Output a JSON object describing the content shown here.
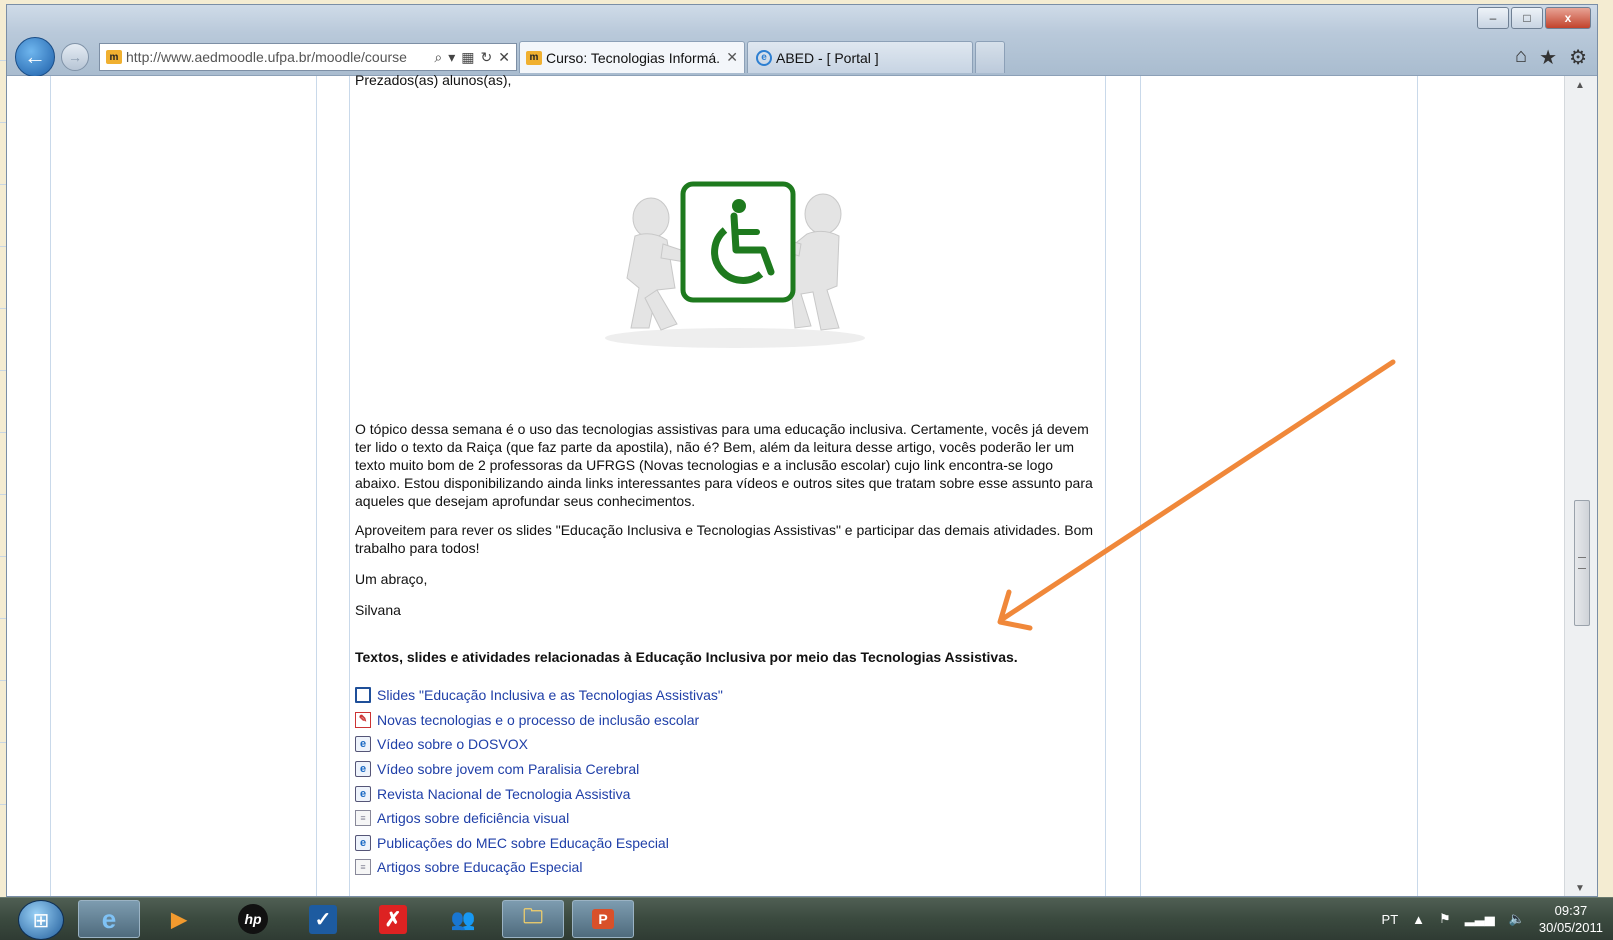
{
  "browser": {
    "address_url": "http://www.aedmoodle.ufpa.br/moodle/course",
    "tabs": [
      {
        "label": "Curso: Tecnologias Informá...",
        "active": true
      },
      {
        "label": "ABED - [ Portal ]",
        "active": false
      }
    ],
    "window_buttons": {
      "minimize": "–",
      "maximize": "□",
      "close": "x"
    },
    "toolbar_icons": [
      "home-icon",
      "star-icon",
      "gear-icon"
    ]
  },
  "content": {
    "greeting": "Prezados(as) alunos(as),",
    "paragraph1": "O tópico dessa semana é o uso das tecnologias assistivas para uma educação inclusiva. Certamente, vocês já devem ter lido o texto da Raiça (que faz parte da apostila), não é? Bem, além da leitura desse artigo, vocês poderão ler  um texto muito bom de 2 professoras da UFRGS (Novas tecnologias e a inclusão escolar) cujo link encontra-se logo abaixo. Estou disponibilizando ainda  links interessantes para vídeos e outros sites que tratam sobre esse assunto para aqueles que desejam  aprofundar seus conhecimentos.",
    "paragraph2": "Aproveitem para rever os slides \"Educação Inclusiva e Tecnologias Assistivas\" e participar das demais atividades. Bom trabalho para todos!",
    "closing": "Um abraço,",
    "signature": "Silvana",
    "section_heading": "Textos, slides e atividades relacionadas à Educação Inclusiva por meio das Tecnologias Assistivas.",
    "links": [
      {
        "icon": "slides-icon",
        "label": "Slides \"Educação Inclusiva e as Tecnologias Assistivas\""
      },
      {
        "icon": "pdf-icon",
        "label": "Novas tecnologias e o processo de inclusão escolar"
      },
      {
        "icon": "web-link-icon",
        "label": "Vídeo sobre o DOSVOX"
      },
      {
        "icon": "web-link-icon",
        "label": "Vídeo sobre jovem com Paralisia Cerebral"
      },
      {
        "icon": "web-link-icon",
        "label": "Revista Nacional de Tecnologia Assistiva"
      },
      {
        "icon": "document-icon",
        "label": "Artigos sobre deficiência visual"
      },
      {
        "icon": "web-link-icon",
        "label": "Publicações do MEC sobre Educação Especial"
      },
      {
        "icon": "document-icon",
        "label": "Artigos sobre Educação Especial"
      }
    ]
  },
  "taskbar": {
    "language": "PT",
    "time": "09:37",
    "date": "30/05/2011",
    "apps": [
      "internet-explorer-icon",
      "media-player-icon",
      "hp-icon",
      "check-icon",
      "antivirus-icon",
      "users-icon",
      "file-explorer-icon",
      "presentation-icon"
    ]
  },
  "colors": {
    "link": "#1f3fa8",
    "annotation_arrow": "#f0883a",
    "accessibility_green": "#1e7a1e"
  }
}
